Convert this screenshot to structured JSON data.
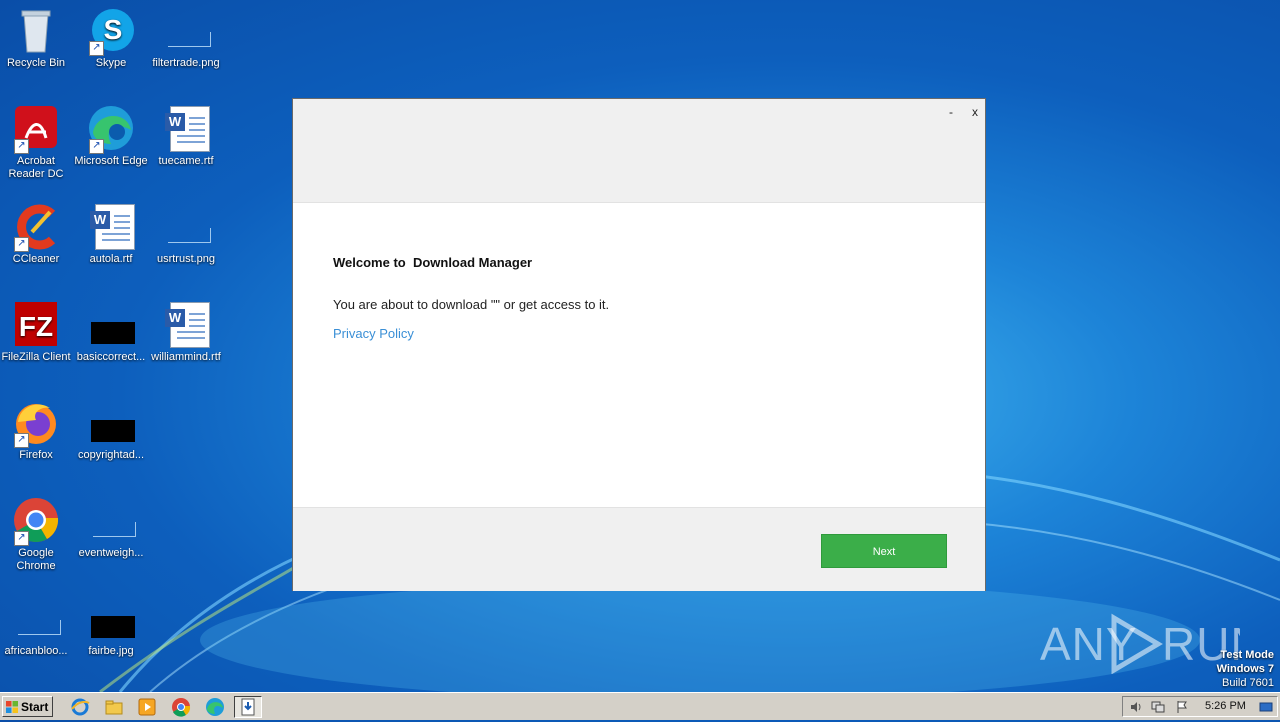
{
  "desktop": {
    "icons": [
      {
        "label": "Recycle Bin"
      },
      {
        "label": "Skype"
      },
      {
        "label": "filtertrade.png"
      },
      {
        "label": "Acrobat Reader DC"
      },
      {
        "label": "Microsoft Edge"
      },
      {
        "label": "tuecame.rtf"
      },
      {
        "label": "CCleaner"
      },
      {
        "label": "autola.rtf"
      },
      {
        "label": "usrtrust.png"
      },
      {
        "label": "FileZilla Client"
      },
      {
        "label": "basiccorrect..."
      },
      {
        "label": "williammind.rtf"
      },
      {
        "label": "Firefox"
      },
      {
        "label": "copyrightad..."
      },
      {
        "label": "Google Chrome"
      },
      {
        "label": "eventweigh..."
      },
      {
        "label": "africanbloo..."
      },
      {
        "label": "fairbe.jpg"
      }
    ]
  },
  "dialog": {
    "minimize_label": "-",
    "close_label": "x",
    "title": "Welcome to  Download Manager",
    "message": "You are about to download \"\" or get access to it.",
    "privacy_link": "Privacy Policy",
    "next_label": "Next",
    "accent_color": "#3bae49"
  },
  "watermark": {
    "brand": "ANY RUN",
    "line1": "Test Mode",
    "line2": "Windows 7",
    "line3": "Build 7601"
  },
  "taskbar": {
    "start_label": "Start",
    "pinned": [
      "ie-icon",
      "explorer-icon",
      "media-player-icon",
      "chrome-icon",
      "edge-icon",
      "download-manager-icon"
    ],
    "clock": "5:26 PM"
  }
}
